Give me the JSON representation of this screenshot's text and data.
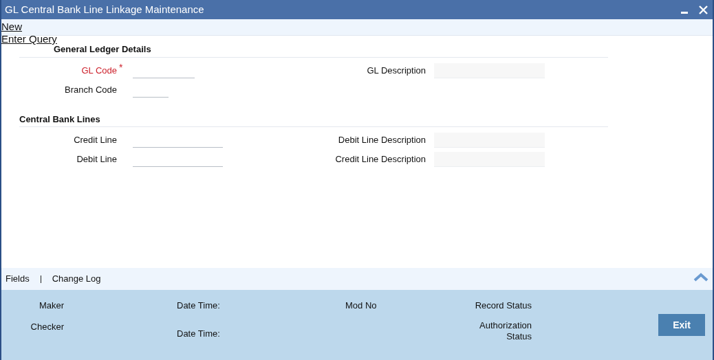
{
  "window": {
    "title": "GL Central Bank Line Linkage Maintenance"
  },
  "toolbar": [
    "New",
    "Enter Query"
  ],
  "sections": [
    {
      "title": "General Ledger Details",
      "rows": [
        {
          "left": {
            "label": "GL Code",
            "required": true,
            "required_mark": "*",
            "kind": "code"
          },
          "right": {
            "label": "GL Description"
          }
        },
        {
          "left": {
            "label": "Branch Code",
            "required": false,
            "kind": "short"
          }
        }
      ]
    },
    {
      "title": "Central Bank Lines",
      "rows": [
        {
          "left": {
            "label": "Credit Line",
            "required": false,
            "kind": "line"
          },
          "right": {
            "label": "Debit Line Description"
          }
        },
        {
          "left": {
            "label": "Debit Line",
            "required": false,
            "kind": "line"
          },
          "right": {
            "label": "Credit Line Description"
          }
        }
      ]
    }
  ],
  "footer_tabs": [
    "Fields",
    "Change Log"
  ],
  "audit": {
    "maker": "Maker",
    "checker": "Checker",
    "maker_date_time": "Date Time:",
    "checker_date_time": "Date Time:",
    "mod_no": "Mod No",
    "record_status": "Record Status",
    "authorization_status": "Authorization Status"
  },
  "buttons": [
    "Exit"
  ]
}
